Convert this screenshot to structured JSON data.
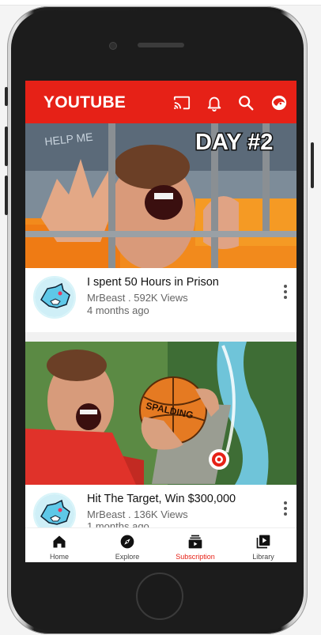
{
  "header": {
    "title": "YOUTUBE"
  },
  "videos": [
    {
      "title": "I spent 50 Hours in Prison",
      "channel_line": "MrBeast . 592K Views",
      "age": "4 months ago",
      "thumb_caption": "DAY #2",
      "thumb_sign": "HELP ME"
    },
    {
      "title": "Hit The Target, Win $300,000",
      "channel_line": "MrBeast . 136K Views",
      "age": "1 months ago",
      "ball_text": "SPALDING"
    }
  ],
  "nav": [
    {
      "label": "Home",
      "icon": "home-icon"
    },
    {
      "label": "Explore",
      "icon": "compass-icon"
    },
    {
      "label": "Subscription",
      "icon": "subscriptions-icon",
      "active": true
    },
    {
      "label": "Library",
      "icon": "library-icon"
    }
  ],
  "colors": {
    "brand": "#e62117",
    "active_nav": "#e62117"
  }
}
